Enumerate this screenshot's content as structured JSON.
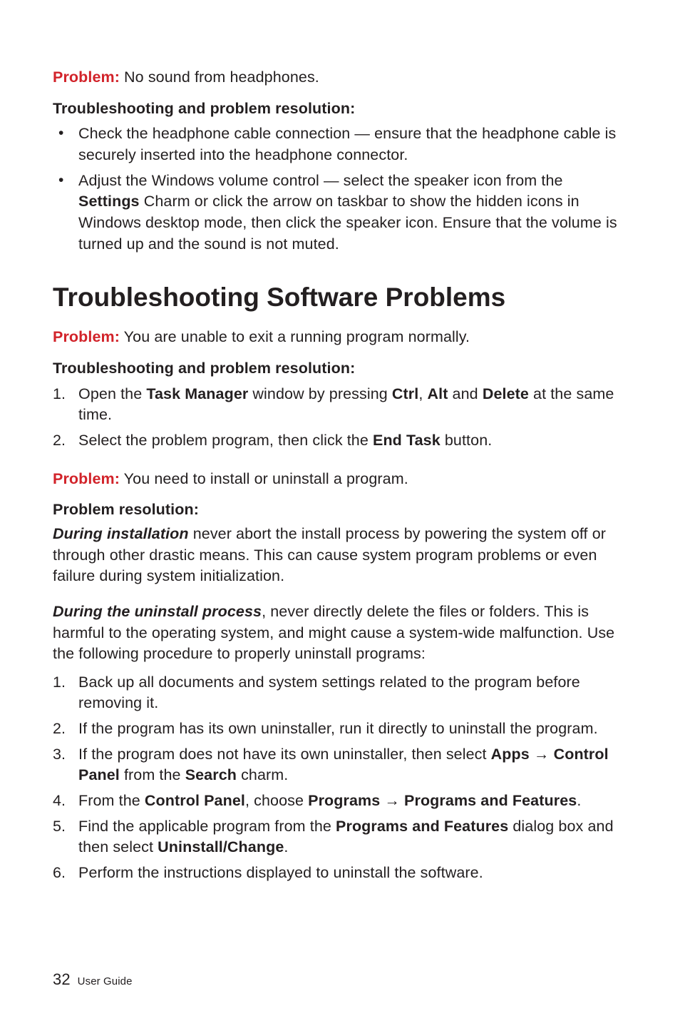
{
  "problem1": {
    "label": "Problem:",
    "text": " No sound from headphones."
  },
  "ts1": {
    "heading": "Troubleshooting and problem resolution:",
    "bullets": [
      {
        "text_a": "Check the headphone cable connection — ensure that the headphone cable is securely inserted into the headphone connector."
      },
      {
        "text_a": "Adjust the Windows volume control — select the speaker icon from the ",
        "bold1": "Settings",
        "text_b": " Charm or click the arrow on taskbar to show the hidden icons in Windows desktop mode, then click the speaker icon. Ensure that the volume is turned up and the sound is not muted."
      }
    ]
  },
  "h1": "Troubleshooting Software Problems",
  "problem2": {
    "label": "Problem:",
    "text": " You are unable to exit a running program normally."
  },
  "ts2": {
    "heading": "Troubleshooting and problem resolution:",
    "steps": [
      {
        "num": "1.",
        "a": "Open the ",
        "b1": "Task Manager",
        "b": " window by pressing ",
        "b2": "Ctrl",
        "c": ", ",
        "b3": "Alt",
        "d": " and ",
        "b4": "Delete",
        "e": " at the same time."
      },
      {
        "num": "2.",
        "a": "Select the problem program, then click the ",
        "b1": "End Task",
        "b": " button."
      }
    ]
  },
  "problem3": {
    "label": "Problem:",
    "text": " You need to install or uninstall a program."
  },
  "res3": {
    "heading": "Problem resolution:",
    "p1": {
      "bi": "During installation",
      "t": " never abort the install process by powering the system off or through other drastic means. This can cause system program problems or even failure during system initialization."
    },
    "p2": {
      "bi": "During the uninstall process",
      "t": ", never directly delete the files or folders. This is harmful to the operating system, and might cause a system-wide malfunction. Use the following procedure to properly uninstall programs:"
    },
    "steps": [
      {
        "num": "1.",
        "a": "Back up all documents and system settings related to the program before removing it."
      },
      {
        "num": "2.",
        "a": "If the program has its own uninstaller, run it directly to uninstall the program."
      },
      {
        "num": "3.",
        "a": "If the program does not have its own uninstaller, then select ",
        "b1": "Apps",
        "arr1": " → ",
        "b2": "Control Panel",
        "b": " from the ",
        "b3": "Search",
        "c": " charm."
      },
      {
        "num": "4.",
        "a": "From the ",
        "b1": "Control Panel",
        "b": ", choose ",
        "b2": "Programs",
        "arr1": " → ",
        "b3": "Programs and Features",
        "c": "."
      },
      {
        "num": "5.",
        "a": "Find the applicable program from the ",
        "b1": "Programs and Features",
        "b": " dialog box and then select ",
        "b2": "Uninstall/Change",
        "c": "."
      },
      {
        "num": "6.",
        "a": "Perform the instructions displayed to uninstall the software."
      }
    ]
  },
  "footer": {
    "page": "32",
    "label": "User Guide"
  }
}
